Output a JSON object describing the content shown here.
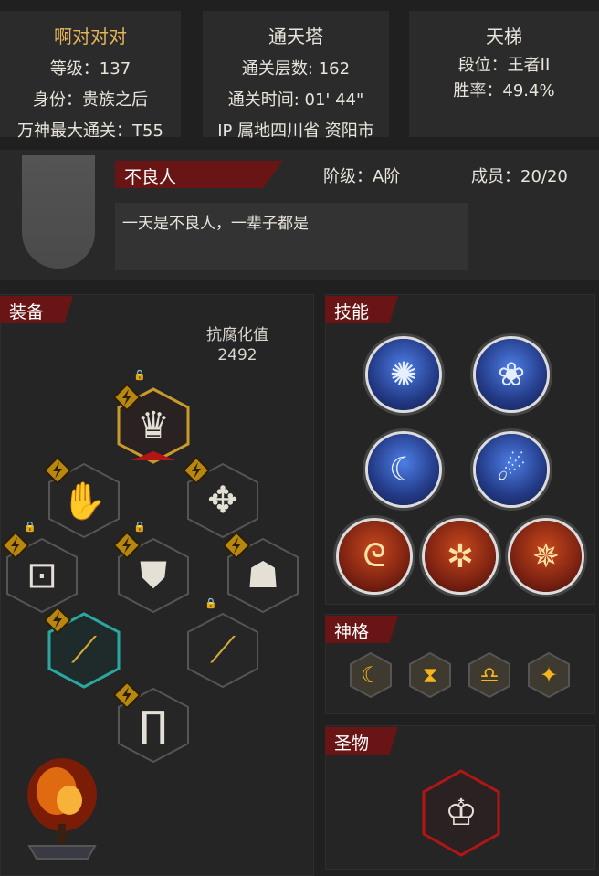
{
  "player": {
    "name": "啊对对对",
    "level": "等级：137",
    "identity": "身份：贵族之后",
    "max_clear": "万神最大通关：T55"
  },
  "tower": {
    "title": "通天塔",
    "floors": "通关层数: 162",
    "time": "通关时间: 01' 44\"",
    "ip": "IP 属地四川省 资阳市"
  },
  "ladder": {
    "title": "天梯",
    "rank": "段位：王者II",
    "winrate": "胜率：49.4%"
  },
  "guild": {
    "name": "不良人",
    "grade": "阶级：A阶",
    "members": "成员：20/20",
    "motto": "一天是不良人，一辈子都是"
  },
  "equipment": {
    "header": "装备",
    "resistance_label": "抗腐化值",
    "resistance_value": "2492"
  },
  "skills": {
    "header": "技能"
  },
  "divinity": {
    "header": "神格"
  },
  "relic": {
    "header": "圣物"
  },
  "colors": {
    "accent_red": "#6a1515",
    "gold": "#e7b45a",
    "hex_red": "#b31515",
    "hex_teal": "#2aa8a0"
  },
  "icons": {
    "equip": [
      "crown-icon",
      "glove-icon",
      "pendant-icon",
      "belt-icon",
      "armor-icon",
      "cloak-icon",
      "twisted-staff-icon",
      "twisted-staff-icon",
      "greaves-icon"
    ],
    "skills": [
      "claw-strike-icon",
      "rose-icon",
      "crescent-icon",
      "meteor-icon",
      "spiral-icon",
      "elements-icon",
      "spider-icon"
    ],
    "divinity": [
      "moon-icon",
      "hourglass-icon",
      "ghost-icon",
      "sparkle-icon"
    ],
    "relic": [
      "crown-relic-icon"
    ]
  }
}
